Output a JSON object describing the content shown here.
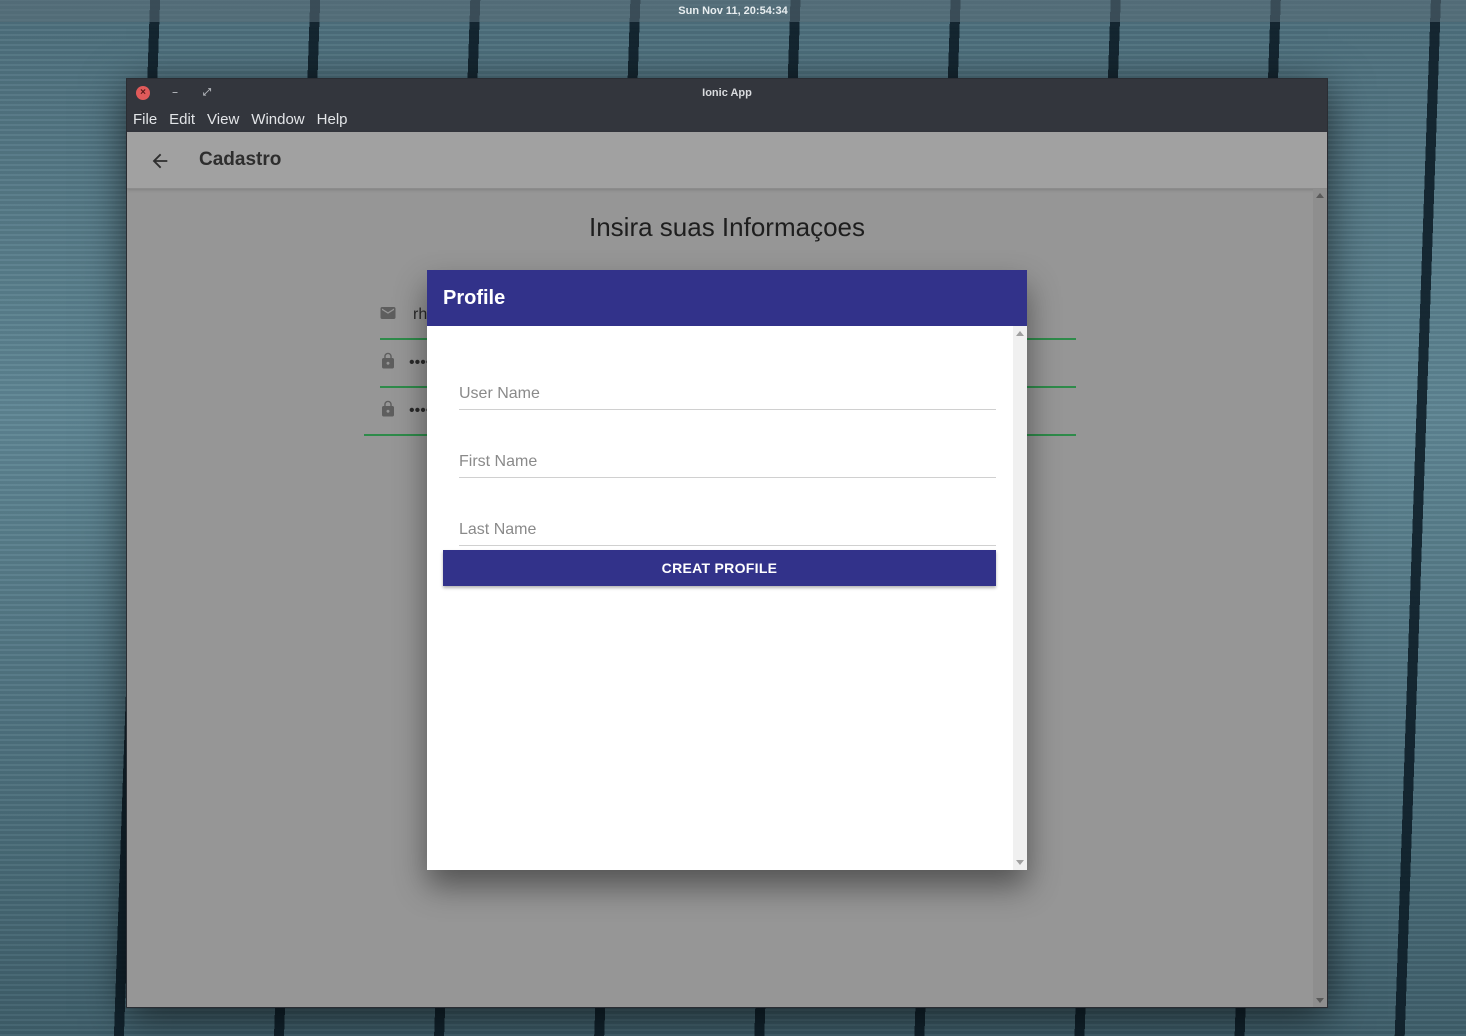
{
  "system": {
    "clock": "Sun Nov 11, 20:54:34"
  },
  "window": {
    "title": "Ionic App",
    "controls": {
      "close": "×",
      "minimize": "–",
      "maximize": "⤢"
    },
    "menu": [
      "File",
      "Edit",
      "View",
      "Window",
      "Help"
    ]
  },
  "toolbar": {
    "title": "Cadastro"
  },
  "content": {
    "heading": "Insira suas Informaçoes",
    "fields": [
      {
        "icon": "mail-icon",
        "value": "rh"
      },
      {
        "icon": "lock-icon",
        "value": "••••"
      },
      {
        "icon": "lock-icon",
        "value": "••••"
      }
    ],
    "accent_color": "#2e8b4a"
  },
  "modal": {
    "title": "Profile",
    "header_color": "#32328a",
    "fields": {
      "username": {
        "placeholder": "User Name"
      },
      "first_name": {
        "placeholder": "First Name"
      },
      "last_name": {
        "placeholder": "Last Name"
      }
    },
    "submit_label": "CREAT PROFILE"
  }
}
